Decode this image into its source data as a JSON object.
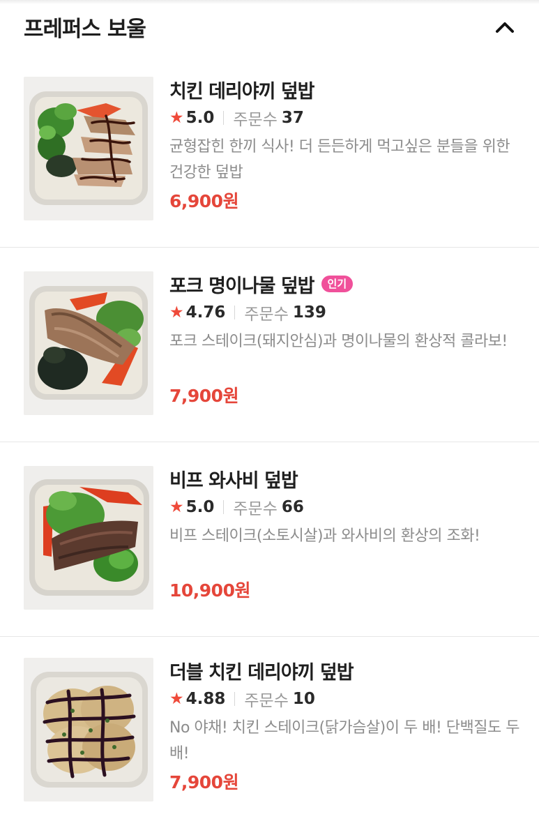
{
  "section": {
    "title": "프레퍼스 보울",
    "collapse_icon": "chevron-up-icon"
  },
  "items": [
    {
      "name": "치킨 데리야끼 덮밥",
      "badge": "",
      "rating": "5.0",
      "orders_label": "주문수",
      "orders": "37",
      "description": "균형잡힌 한끼 식사! 더 든든하게 먹고싶은 분들을 위한 건강한 덮밥",
      "price": "6,900원"
    },
    {
      "name": "포크 명이나물 덮밥",
      "badge": "인기",
      "rating": "4.76",
      "orders_label": "주문수",
      "orders": "139",
      "description": "포크 스테이크(돼지안심)과 명이나물의 환상적 콜라보!",
      "price": "7,900원"
    },
    {
      "name": "비프 와사비 덮밥",
      "badge": "",
      "rating": "5.0",
      "orders_label": "주문수",
      "orders": "66",
      "description": "비프 스테이크(소토시살)과 와사비의 환상의 조화!",
      "price": "10,900원"
    },
    {
      "name": "더블 치킨 데리야끼 덮밥",
      "badge": "",
      "rating": "4.88",
      "orders_label": "주문수",
      "orders": "10",
      "description": "No 야채! 치킨 스테이크(닭가슴살)이 두 배! 단백질도 두 배!",
      "price": "7,900원"
    }
  ],
  "colors": {
    "price": "#e5463a",
    "star": "#ef4a3a",
    "badge": "#f0509a"
  }
}
